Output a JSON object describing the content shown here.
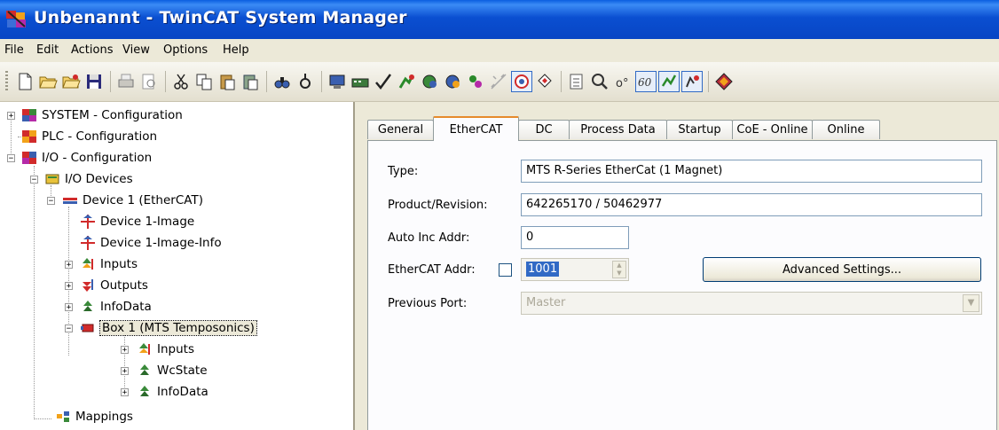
{
  "window": {
    "title": "Unbenannt - TwinCAT System Manager"
  },
  "menu": [
    "File",
    "Edit",
    "Actions",
    "View",
    "Options",
    "Help"
  ],
  "toolbar": {
    "buttons": [
      "new-file-icon",
      "open-folder-icon",
      "open-project-icon",
      "save-icon",
      "print-icon",
      "print-preview-icon",
      "cut-icon",
      "copy-icon",
      "paste-icon",
      "paste-with-links-icon",
      "find-icon",
      "find-next-icon",
      "generate-mappings-icon",
      "check-configuration-icon",
      "activate-configuration-icon",
      "set-run-mode-icon",
      "restart-config-mode-icon",
      "reload-devices-icon",
      "scan-devices-icon",
      "toggle-free-run-icon",
      "show-online-data-icon",
      "show-sub-items-icon",
      "settings-icon",
      "zoom-icon",
      "auto-scroll-icon",
      "show-mapping-icon",
      "target-system-icon",
      "config-mode-icon",
      "run-mode-icon",
      "help-icon"
    ]
  },
  "tree": {
    "items": [
      {
        "label": "SYSTEM - Configuration",
        "icon": "system-icon"
      },
      {
        "label": "PLC - Configuration",
        "icon": "plc-icon"
      },
      {
        "label": "I/O - Configuration",
        "icon": "io-icon"
      },
      {
        "label": "I/O Devices",
        "icon": "io-devices-icon"
      },
      {
        "label": "Device 1 (EtherCAT)",
        "icon": "ethercat-device-icon"
      },
      {
        "label": "Device 1-Image",
        "icon": "image-icon"
      },
      {
        "label": "Device 1-Image-Info",
        "icon": "image-info-icon"
      },
      {
        "label": "Inputs",
        "icon": "inputs-icon"
      },
      {
        "label": "Outputs",
        "icon": "outputs-icon"
      },
      {
        "label": "InfoData",
        "icon": "infodata-icon"
      },
      {
        "label": "Box 1 (MTS Temposonics)",
        "icon": "box-icon"
      },
      {
        "label": "Inputs",
        "icon": "inputs-icon"
      },
      {
        "label": "WcState",
        "icon": "wcstate-icon"
      },
      {
        "label": "InfoData",
        "icon": "infodata-icon"
      },
      {
        "label": "Mappings",
        "icon": "mappings-icon"
      }
    ]
  },
  "tabs": [
    "General",
    "EtherCAT",
    "DC",
    "Process Data",
    "Startup",
    "CoE - Online",
    "Online"
  ],
  "active_tab": "EtherCAT",
  "ethercat": {
    "type_label": "Type:",
    "type_value": "MTS R-Series EtherCat (1 Magnet)",
    "product_label": "Product/Revision:",
    "product_value": "642265170 / 50462977",
    "autoinc_label": "Auto Inc Addr:",
    "autoinc_value": "0",
    "ecaddr_label": "EtherCAT Addr:",
    "ecaddr_value": "1001",
    "advanced_button": "Advanced Settings...",
    "prevport_label": "Previous Port:",
    "prevport_value": "Master"
  },
  "colors": {
    "titlebar": "#0a4fd1",
    "tab_highlight": "#e68b2c",
    "selection": "#316ac5"
  }
}
